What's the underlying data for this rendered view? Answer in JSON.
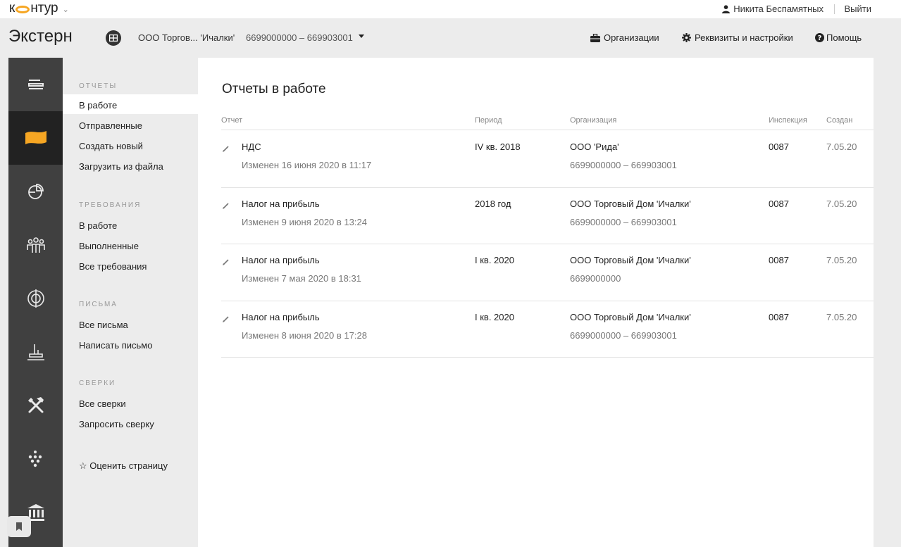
{
  "topbar": {
    "logo_left": "к",
    "logo_right": "нтур",
    "user_name": "Никита Беспамятных",
    "logout": "Выйти"
  },
  "header": {
    "brand": "Экстерн",
    "org_name": "ООО Торгов... 'Ичалки'",
    "org_inn": "6699000000 – 669903001",
    "nav": {
      "organizations": "Организации",
      "settings": "Реквизиты и настройки",
      "help": "Помощь"
    }
  },
  "rail": {
    "items": [
      "menu-icon",
      "flag-icon",
      "pie-chart-icon",
      "people-icon",
      "compass-icon",
      "factory-icon",
      "tools-icon",
      "grapes-icon",
      "bank-icon"
    ],
    "active_color": "#f6a623"
  },
  "submenu": {
    "reports_title": "ОТЧЕТЫ",
    "reports": [
      "В работе",
      "Отправленные",
      "Создать новый",
      "Загрузить из файла"
    ],
    "requirements_title": "ТРЕБОВАНИЯ",
    "requirements": [
      "В работе",
      "Выполненные",
      "Все требования"
    ],
    "letters_title": "ПИСЬМА",
    "letters": [
      "Все письма",
      "Написать письмо"
    ],
    "reconciliations_title": "СВЕРКИ",
    "reconciliations": [
      "Все сверки",
      "Запросить сверку"
    ],
    "rate_page": "☆ Оценить страницу"
  },
  "main": {
    "title": "Отчеты в работе",
    "columns": {
      "report": "Отчет",
      "period": "Период",
      "organization": "Организация",
      "inspection": "Инспекция",
      "created": "Создан"
    },
    "rows": [
      {
        "name": "НДС",
        "changed": "Изменен 16 июня 2020 в 11:17",
        "period": "IV кв. 2018",
        "org": "ООО 'Рида'",
        "org_inn": "6699000000 – 669903001",
        "inspection": "0087",
        "created": "7.05.20"
      },
      {
        "name": "Налог на прибыль",
        "changed": "Изменен 9 июня 2020 в 13:24",
        "period": "2018 год",
        "org": "ООО Торговый Дом 'Ичалки'",
        "org_inn": "6699000000 – 669903001",
        "inspection": "0087",
        "created": "7.05.20"
      },
      {
        "name": "Налог на прибыль",
        "changed": "Изменен 7 мая 2020 в 18:31",
        "period": "I кв. 2020",
        "org": "ООО Торговый Дом 'Ичалки'",
        "org_inn": "6699000000",
        "inspection": "0087",
        "created": "7.05.20"
      },
      {
        "name": "Налог на прибыль",
        "changed": "Изменен 8 июня 2020 в 17:28",
        "period": "I кв. 2020",
        "org": "ООО Торговый Дом 'Ичалки'",
        "org_inn": "6699000000 – 669903001",
        "inspection": "0087",
        "created": "7.05.20"
      }
    ]
  }
}
